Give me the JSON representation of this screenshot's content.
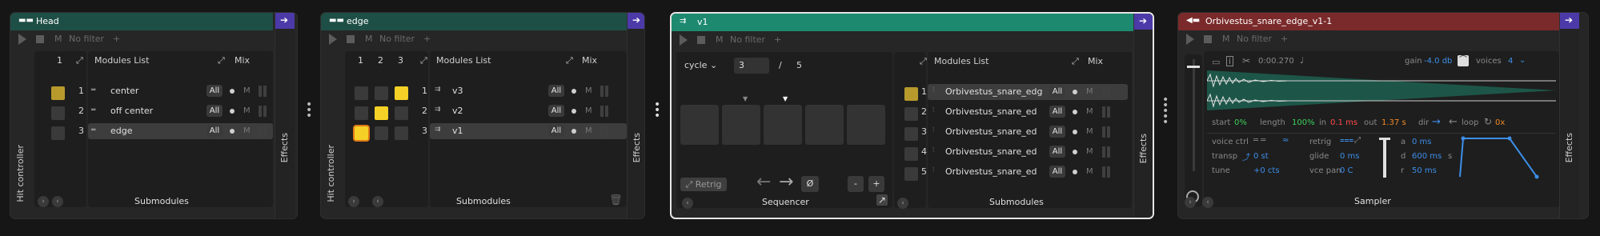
{
  "colors": {
    "head_bar": "#1e4f46",
    "seq_bar": "#1d8a70",
    "sampler_bar": "#7a2a2a",
    "effects_tab": "#4b3aa8",
    "pad_on": "#f5d127",
    "accent_blue": "#3d8ee8"
  },
  "devices": {
    "head": {
      "title": "Head",
      "transport": {
        "m": "M",
        "filter": "No filter",
        "plus": "+"
      },
      "pads_header": "1",
      "list_header": "Modules List",
      "mix_header": "Mix",
      "side_label": "Hit controller",
      "effects_label": "Effects",
      "bottom_label": "Submodules",
      "rows": [
        {
          "num": "1",
          "name": "center",
          "all": "All",
          "m": "M"
        },
        {
          "num": "2",
          "name": "off center",
          "all": "All",
          "m": "M"
        },
        {
          "num": "3",
          "name": "edge",
          "all": "All",
          "m": "M"
        }
      ]
    },
    "edge": {
      "title": "edge",
      "transport": {
        "m": "M",
        "filter": "No filter",
        "plus": "+"
      },
      "pad_cols": [
        "1",
        "2",
        "3"
      ],
      "list_header": "Modules List",
      "mix_header": "Mix",
      "side_label": "Hit controller",
      "effects_label": "Effects",
      "bottom_label": "Submodules",
      "rows": [
        {
          "num": "1",
          "name": "v3",
          "all": "All",
          "m": "M"
        },
        {
          "num": "2",
          "name": "v2",
          "all": "All",
          "m": "M"
        },
        {
          "num": "3",
          "name": "v1",
          "all": "All",
          "m": "M"
        }
      ]
    },
    "v1": {
      "title": "v1",
      "transport": {
        "m": "M",
        "filter": "No filter",
        "plus": "+"
      },
      "cycle_label": "cycle",
      "step_value": "3",
      "slash": "/",
      "step_total": "5",
      "retrig_label": "Retrig",
      "zero_label": "Ø",
      "minus_label": "-",
      "plus_label": "+",
      "bottom_label": "Sequencer",
      "list_header": "Modules List",
      "mix_header": "Mix",
      "effects_label": "Effects",
      "sub_bottom_label": "Submodules",
      "rows": [
        {
          "num": "1",
          "name": "Orbivestus_snare_edg",
          "all": "All",
          "m": "M"
        },
        {
          "num": "2",
          "name": "Orbivestus_snare_ed",
          "all": "All",
          "m": "M"
        },
        {
          "num": "3",
          "name": "Orbivestus_snare_ed",
          "all": "All",
          "m": "M"
        },
        {
          "num": "4",
          "name": "Orbivestus_snare_ed",
          "all": "All",
          "m": "M"
        },
        {
          "num": "5",
          "name": "Orbivestus_snare_ed",
          "all": "All",
          "m": "M"
        }
      ]
    },
    "sampler": {
      "title": "Orbivestus_snare_edge_v1-1",
      "transport": {
        "m": "M",
        "filter": "No filter",
        "plus": "+"
      },
      "time": "0:00.270",
      "gain_label": "gain",
      "gain_value": "-4.0 db",
      "voices_label": "voices",
      "voices_value": "4",
      "start_label": "start",
      "start_value": "0%",
      "length_label": "length",
      "length_value": "100%",
      "in_label": "in",
      "in_value": "0.1 ms",
      "out_label": "out",
      "out_value": "1.37 s",
      "dir_label": "dir",
      "loop_label": "loop",
      "loop_value": "0x",
      "voice_ctrl_label": "voice ctrl",
      "retrig_label": "retrig",
      "transp_label": "transp",
      "transp_value": "0 st",
      "glide_label": "glide",
      "glide_value": "0 ms",
      "tune_label": "tune",
      "tune_value": "+0 cts",
      "vce_pan_label": "vce pan",
      "vce_pan_value": "0 C",
      "env": {
        "a_label": "a",
        "a_value": "0 ms",
        "d_label": "d",
        "d_value": "600 ms",
        "s_label": "s",
        "r_label": "r",
        "r_value": "50 ms"
      },
      "effects_label": "Effects",
      "bottom_label": "Sampler"
    }
  }
}
